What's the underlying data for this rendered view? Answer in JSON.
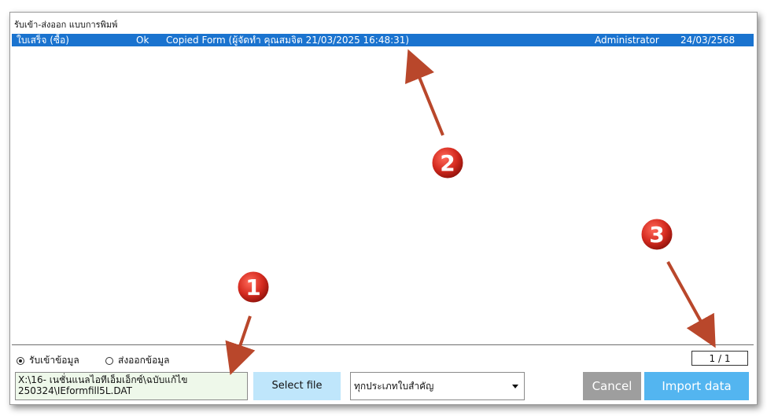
{
  "window": {
    "title": "รับเข้า-ส่งออก แบบการพิมพ์"
  },
  "list": {
    "rows": [
      {
        "type": "ใบเสร็จ (ซื้อ)",
        "status": "Ok",
        "description": "Copied Form (ผู้จัดทำ คุณสมจิต  21/03/2025  16:48:31)",
        "user": "Administrator",
        "date": "24/03/2568"
      }
    ]
  },
  "mode": {
    "import_label": "รับเข้าข้อมูล",
    "export_label": "ส่งออกข้อมูล",
    "selected": "import"
  },
  "pager": {
    "text": "1 / 1"
  },
  "file_path": {
    "line1": "X:\\16- เนชั่นแนลไอทีเอ็มเอ็กซ์\\ฉบับแก้ไข",
    "line2": "250324\\IEformfill5L.DAT"
  },
  "buttons": {
    "select_file": "Select file",
    "cancel": "Cancel",
    "import": "Import data"
  },
  "category_select": {
    "value": "ทุกประเภทใบสำคัญ"
  },
  "annotations": {
    "badge1": "1",
    "badge2": "2",
    "badge3": "3",
    "badge_color": "#d42a1f",
    "arrow_color": "#b9472b"
  },
  "colors": {
    "selection": "#1a73cf",
    "import_button": "#53b5f0",
    "select_button": "#bfe6fb",
    "cancel_button": "#9e9e9e"
  }
}
